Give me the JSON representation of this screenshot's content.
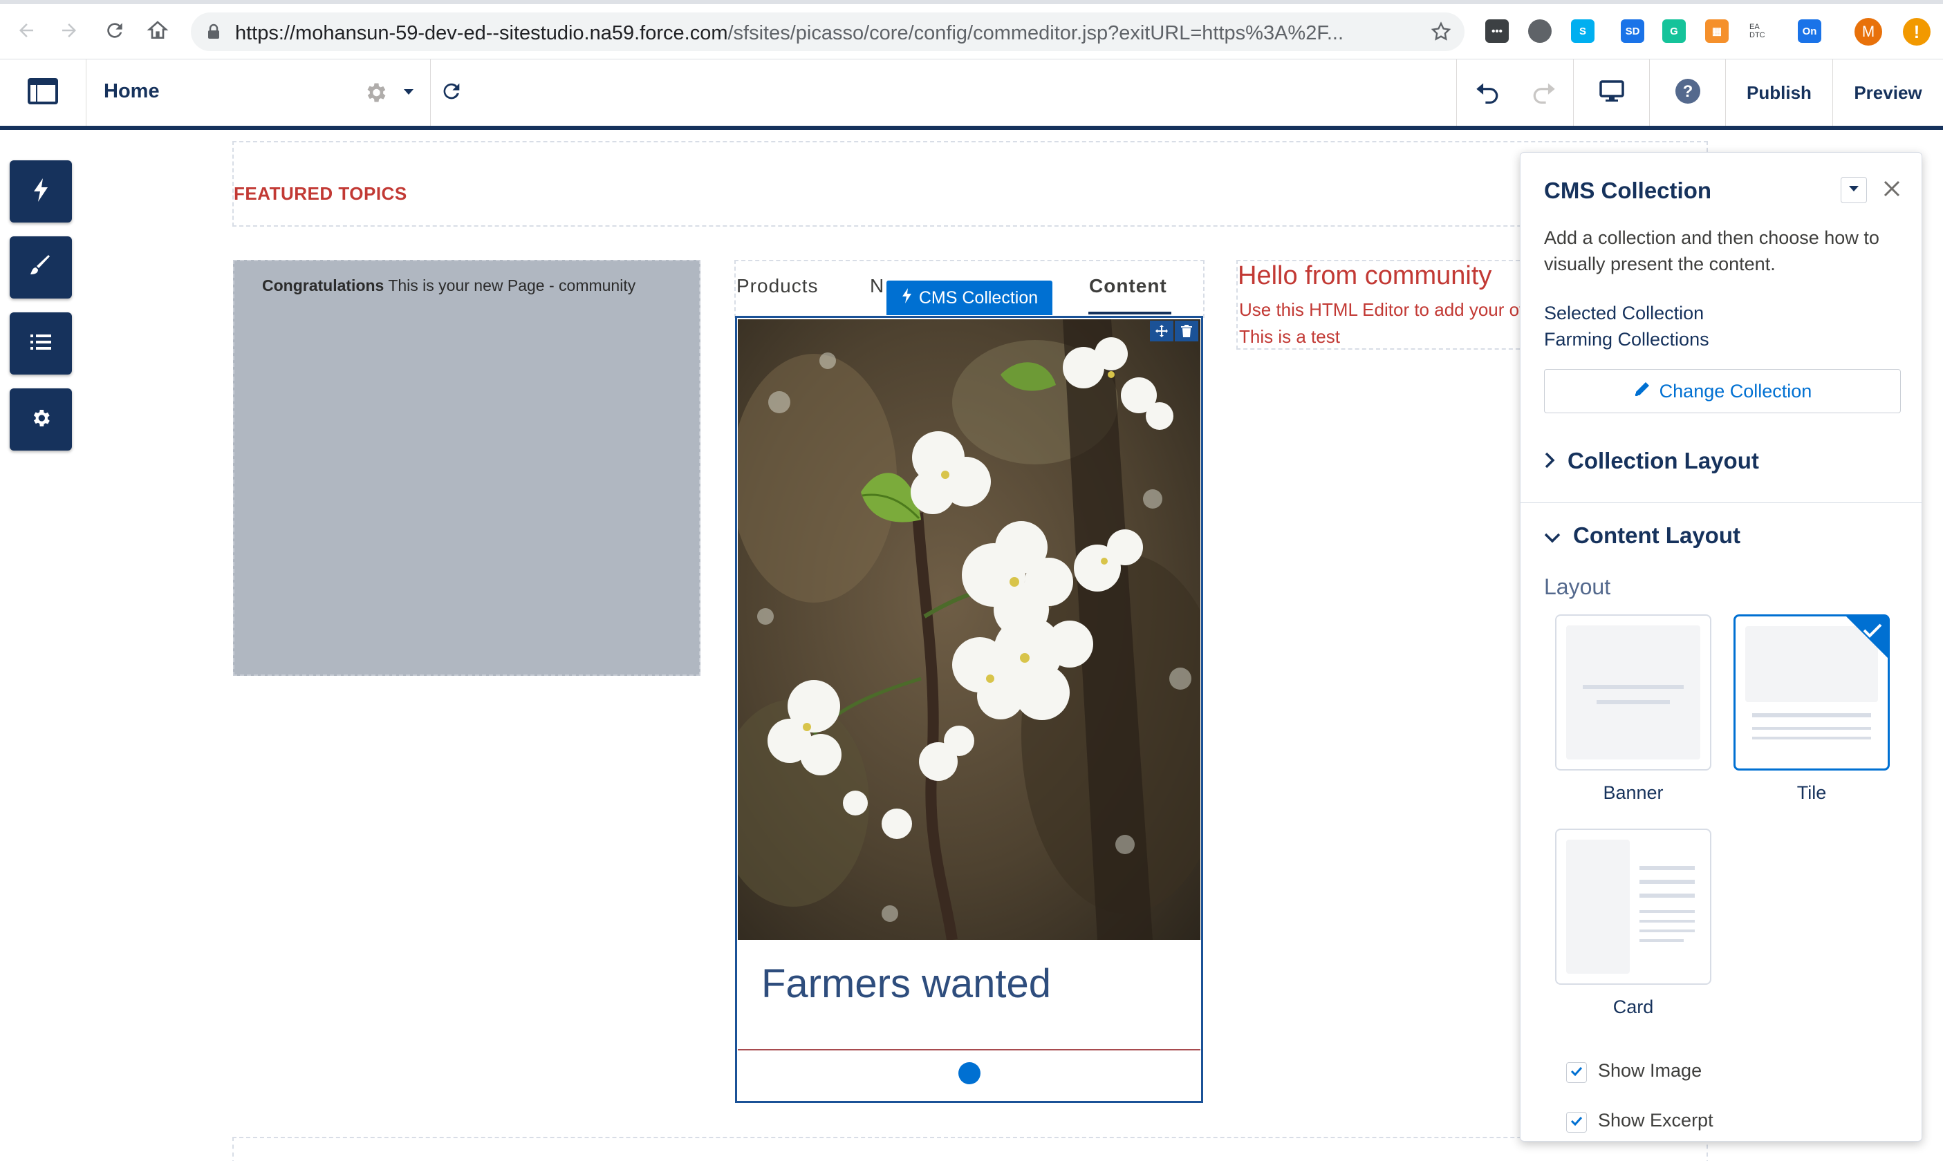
{
  "browser": {
    "url_host": "https://mohansun-59-dev-ed--sitestudio.na59.force.com",
    "url_path": "/sfsites/picasso/core/config/commeditor.jsp?exitURL=https%3A%2F...",
    "extensions": [
      {
        "name": "dots-extension",
        "label": "•••",
        "color": "#3c4043"
      },
      {
        "name": "circle-extension",
        "label": "",
        "color": "#5f6368"
      },
      {
        "name": "skype-extension",
        "label": "S",
        "color": "#00aff0"
      },
      {
        "name": "sd-extension",
        "label": "SD",
        "color": "#1a73e8"
      },
      {
        "name": "grammarly-extension",
        "label": "G",
        "color": "#15c39a"
      },
      {
        "name": "orange-extension",
        "label": "▦",
        "color": "#f5902b"
      },
      {
        "name": "ea-dtc-extension",
        "label": "EA DTC",
        "color": "#ffffff"
      },
      {
        "name": "on-extension",
        "label": "On",
        "color": "#1a73e8"
      }
    ],
    "avatar": "M",
    "alert": "!"
  },
  "header": {
    "page": "Home",
    "publish": "Publish",
    "preview": "Preview"
  },
  "canvas": {
    "featured_topics": "FEATURED TOPICS",
    "welcome_bold": "Congratulations",
    "welcome_rest": " This is your new Page - community",
    "tabs": [
      "Products",
      "N",
      "Content"
    ],
    "cms_badge": "CMS Collection",
    "card_title": "Farmers wanted",
    "hello_title": "Hello from community",
    "hello_line1": "Use this HTML Editor to add your ov",
    "hello_line2": "This is a test"
  },
  "panel": {
    "title": "CMS Collection",
    "description_1": "Add a collection and then choose how to",
    "description_2": "visually present the content.",
    "selected_label": "Selected Collection",
    "selected_value": "Farming Collections",
    "change_button": "Change Collection",
    "collection_layout": "Collection Layout",
    "content_layout": "Content Layout",
    "layout_label": "Layout",
    "layouts": [
      {
        "label": "Banner",
        "selected": false
      },
      {
        "label": "Tile",
        "selected": true
      },
      {
        "label": "Card",
        "selected": false
      }
    ],
    "show_image": "Show Image",
    "show_image_checked": true,
    "show_excerpt": "Show Excerpt",
    "show_excerpt_checked": true
  },
  "colors": {
    "navy": "#16325c",
    "brand_blue": "#0070d2",
    "featured_red": "#c23934"
  }
}
